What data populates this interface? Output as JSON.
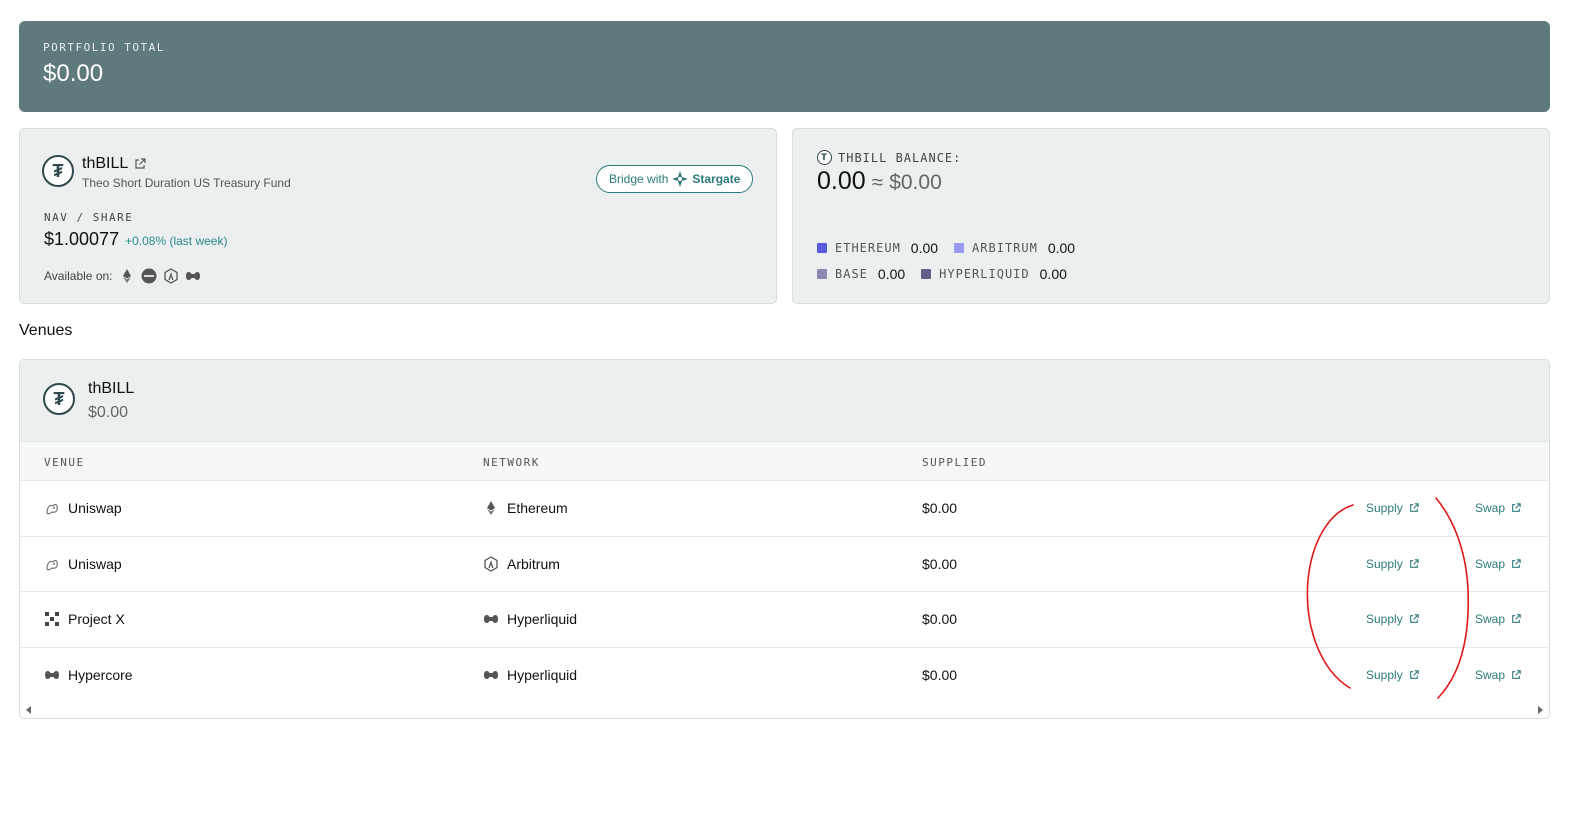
{
  "portfolio": {
    "label": "PORTFOLIO TOTAL",
    "value": "$0.00"
  },
  "fund": {
    "name": "thBILL",
    "subtitle": "Theo Short Duration US Treasury Fund",
    "bridge_prefix": "Bridge with",
    "bridge_brand": "Stargate",
    "nav_label": "NAV / SHARE",
    "nav_value": "$1.00077",
    "nav_change": "+0.08% (last week)",
    "available_label": "Available on:",
    "available_icons": [
      "ethereum-icon",
      "base-icon",
      "arbitrum-icon",
      "hyperliquid-icon"
    ]
  },
  "balance": {
    "label": "THBILL BALANCE:",
    "amount": "0.00",
    "approx": "≈",
    "usd": "$0.00",
    "chains": [
      {
        "name": "ETHEREUM",
        "value": "0.00",
        "color": "#5b5be0"
      },
      {
        "name": "ARBITRUM",
        "value": "0.00",
        "color": "#9a9af0"
      },
      {
        "name": "BASE",
        "value": "0.00",
        "color": "#8a8ab0"
      },
      {
        "name": "HYPERLIQUID",
        "value": "0.00",
        "color": "#5f5f8a"
      }
    ]
  },
  "venues": {
    "title": "Venues",
    "token": "thBILL",
    "token_value": "$0.00",
    "columns": [
      "VENUE",
      "NETWORK",
      "SUPPLIED"
    ],
    "rows": [
      {
        "venue": "Uniswap",
        "venue_icon": "uniswap-icon",
        "network": "Ethereum",
        "network_icon": "ethereum-icon",
        "supplied": "$0.00",
        "supply": "Supply",
        "swap": "Swap"
      },
      {
        "venue": "Uniswap",
        "venue_icon": "uniswap-icon",
        "network": "Arbitrum",
        "network_icon": "arbitrum-icon",
        "supplied": "$0.00",
        "supply": "Supply",
        "swap": "Swap"
      },
      {
        "venue": "Project X",
        "venue_icon": "project-x-icon",
        "network": "Hyperliquid",
        "network_icon": "hyperliquid-icon",
        "supplied": "$0.00",
        "supply": "Supply",
        "swap": "Swap"
      },
      {
        "venue": "Hypercore",
        "venue_icon": "hypercore-icon",
        "network": "Hyperliquid",
        "network_icon": "hyperliquid-icon",
        "supplied": "$0.00",
        "supply": "Supply",
        "swap": "Swap"
      }
    ]
  },
  "colors": {
    "header_bg": "#5f7a7c",
    "accent": "#2c7a7b",
    "annotation": "#e01818"
  }
}
